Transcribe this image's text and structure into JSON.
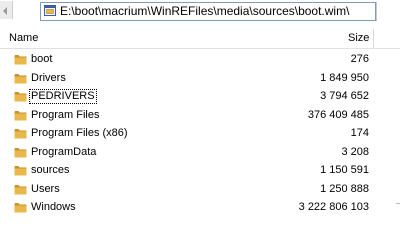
{
  "address_bar": {
    "path": "E:\\boot\\macrium\\WinREFiles\\media\\sources\\boot.wim\\"
  },
  "columns": {
    "name": "Name",
    "size": "Size"
  },
  "items": [
    {
      "name": "boot",
      "size": "276",
      "icon": "folder-icon"
    },
    {
      "name": "Drivers",
      "size": "1 849 950",
      "icon": "folder-icon"
    },
    {
      "name": "PEDRIVERS",
      "size": "3 794 652",
      "icon": "folder-icon",
      "focused": true
    },
    {
      "name": "Program Files",
      "size": "376 409 485",
      "icon": "folder-icon"
    },
    {
      "name": "Program Files (x86)",
      "size": "174",
      "icon": "folder-icon"
    },
    {
      "name": "ProgramData",
      "size": "3 208",
      "icon": "folder-icon"
    },
    {
      "name": "sources",
      "size": "1 150 591",
      "icon": "folder-icon"
    },
    {
      "name": "Users",
      "size": "1 250 888",
      "icon": "folder-icon"
    },
    {
      "name": "Windows",
      "size": "3 222 806 103",
      "icon": "folder-icon"
    }
  ],
  "colors": {
    "folder": "#e8b84a",
    "folder_dark": "#c8922a",
    "address_border": "#7f9db9"
  }
}
